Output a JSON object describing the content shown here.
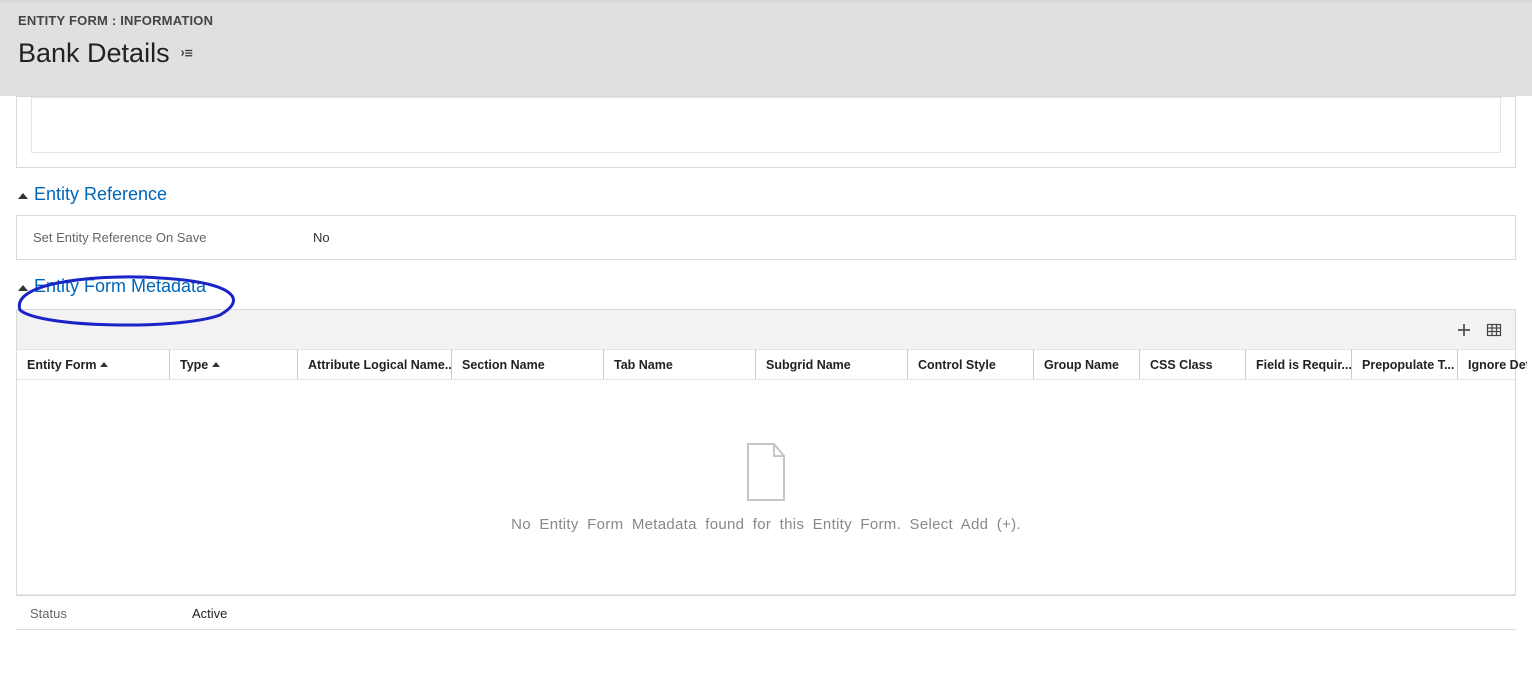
{
  "header": {
    "type": "ENTITY FORM : INFORMATION",
    "title": "Bank Details"
  },
  "sections": {
    "entity_reference": {
      "title": "Entity Reference",
      "field_label": "Set Entity Reference On Save",
      "field_value": "No"
    },
    "entity_form_metadata": {
      "title": "Entity Form Metadata",
      "columns": [
        "Entity Form",
        "Type",
        "Attribute Logical Name...",
        "Section Name",
        "Tab Name",
        "Subgrid Name",
        "Control Style",
        "Group Name",
        "CSS Class",
        "Field is Requir...",
        "Prepopulate T...",
        "Ignore Def"
      ],
      "empty_message": "No Entity Form Metadata found for this Entity Form. Select Add (+)."
    }
  },
  "footer": {
    "status_label": "Status",
    "status_value": "Active"
  }
}
